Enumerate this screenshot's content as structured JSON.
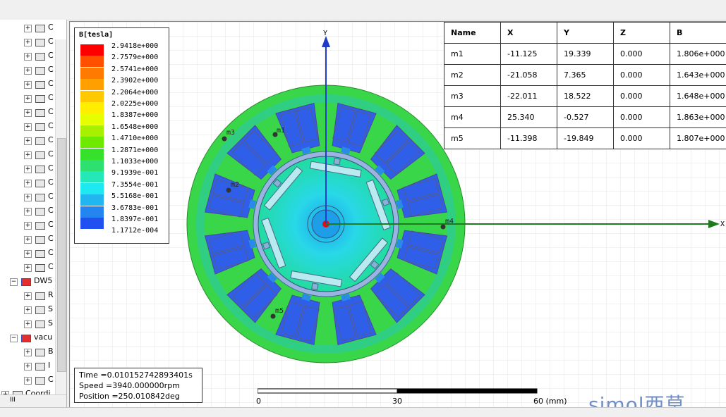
{
  "tree": {
    "rows": [
      {
        "label": "C",
        "level": 2
      },
      {
        "label": "C",
        "level": 2
      },
      {
        "label": "C",
        "level": 2
      },
      {
        "label": "C",
        "level": 2
      },
      {
        "label": "C",
        "level": 2
      },
      {
        "label": "C",
        "level": 2
      },
      {
        "label": "C",
        "level": 2
      },
      {
        "label": "C",
        "level": 2
      },
      {
        "label": "C",
        "level": 2
      },
      {
        "label": "C",
        "level": 2
      },
      {
        "label": "C",
        "level": 2
      },
      {
        "label": "C",
        "level": 2
      },
      {
        "label": "C",
        "level": 2
      },
      {
        "label": "C",
        "level": 2
      },
      {
        "label": "C",
        "level": 2
      },
      {
        "label": "C",
        "level": 2
      },
      {
        "label": "C",
        "level": 2
      },
      {
        "label": "C",
        "level": 2
      },
      {
        "label": "DW5",
        "level": 1
      },
      {
        "label": "R",
        "level": 2
      },
      {
        "label": "S",
        "level": 2
      },
      {
        "label": "S",
        "level": 2
      },
      {
        "label": "vacu",
        "level": 1
      },
      {
        "label": "B",
        "level": 2
      },
      {
        "label": "I",
        "level": 2
      },
      {
        "label": "C",
        "level": 2
      },
      {
        "label": "Coordi",
        "level": 0
      }
    ],
    "scroll_grip": "III"
  },
  "legend": {
    "title": "B[tesla]",
    "values": [
      "2.9418e+000",
      "2.7579e+000",
      "2.5741e+000",
      "2.3902e+000",
      "2.2064e+000",
      "2.0225e+000",
      "1.8387e+000",
      "1.6548e+000",
      "1.4710e+000",
      "1.2871e+000",
      "1.1033e+000",
      "9.1939e-001",
      "7.3554e-001",
      "5.5168e-001",
      "3.6783e-001",
      "1.8397e-001",
      "1.1712e-004"
    ],
    "colors": [
      "#ff0000",
      "#ff5000",
      "#ff7a00",
      "#ffa000",
      "#ffc800",
      "#ffee00",
      "#e6ff00",
      "#a8f000",
      "#6eea00",
      "#35e12a",
      "#2ee070",
      "#25e8b8",
      "#1ee8f0",
      "#21b6f0",
      "#2485f0",
      "#2050f0",
      "#1010ee"
    ]
  },
  "markers_table": {
    "headers": [
      "Name",
      "X",
      "Y",
      "Z",
      "B"
    ],
    "rows": [
      [
        "m1",
        "-11.125",
        "19.339",
        "0.000",
        "1.806e+000"
      ],
      [
        "m2",
        "-21.058",
        "7.365",
        "0.000",
        "1.643e+000"
      ],
      [
        "m3",
        "-22.011",
        "18.522",
        "0.000",
        "1.648e+000"
      ],
      [
        "m4",
        "25.340",
        "-0.527",
        "0.000",
        "1.863e+000"
      ],
      [
        "m5",
        "-11.398",
        "-19.849",
        "0.000",
        "1.807e+000"
      ]
    ]
  },
  "axes": {
    "x_label": "X",
    "y_label": "Y"
  },
  "markers": {
    "m1": "m1",
    "m2": "m2",
    "m3": "m3",
    "m4": "m4",
    "m5": "m5"
  },
  "info": {
    "time": "Time    =0.010152742893401s",
    "speed": "Speed   =3940.000000rpm",
    "position": "Position =250.010842deg"
  },
  "scale": {
    "labels": [
      "0",
      "30",
      "60 (mm)"
    ]
  },
  "brand": "simol西莫",
  "colors": {
    "stator_green": "#3ad64a",
    "slot_blue": "#2f5fe8",
    "axis_blue": "#1e3cc8",
    "axis_green": "#1e7a1e"
  }
}
